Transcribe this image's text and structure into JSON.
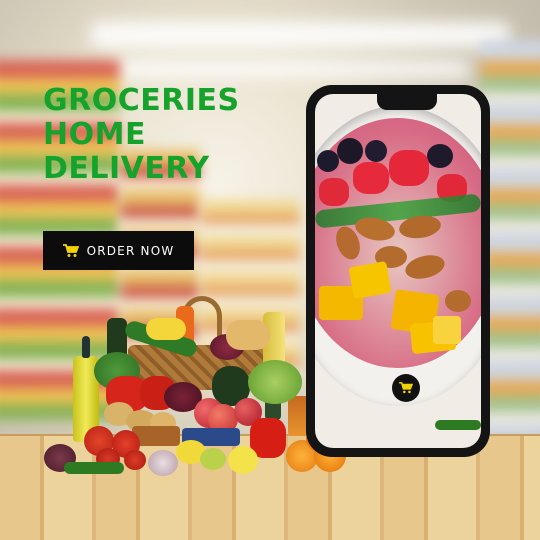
{
  "headline": {
    "line1": "GROCERIES",
    "line2": "HOME",
    "line3": "DELIVERY"
  },
  "cta": {
    "label": "ORDER NOW",
    "icon": "shopping-cart-icon"
  },
  "phone": {
    "cart_icon": "shopping-cart-icon"
  },
  "colors": {
    "headline": "#16a32c",
    "button_bg": "#0c0c0c",
    "button_text": "#ffffff",
    "cart_icon": "#f2d200"
  }
}
